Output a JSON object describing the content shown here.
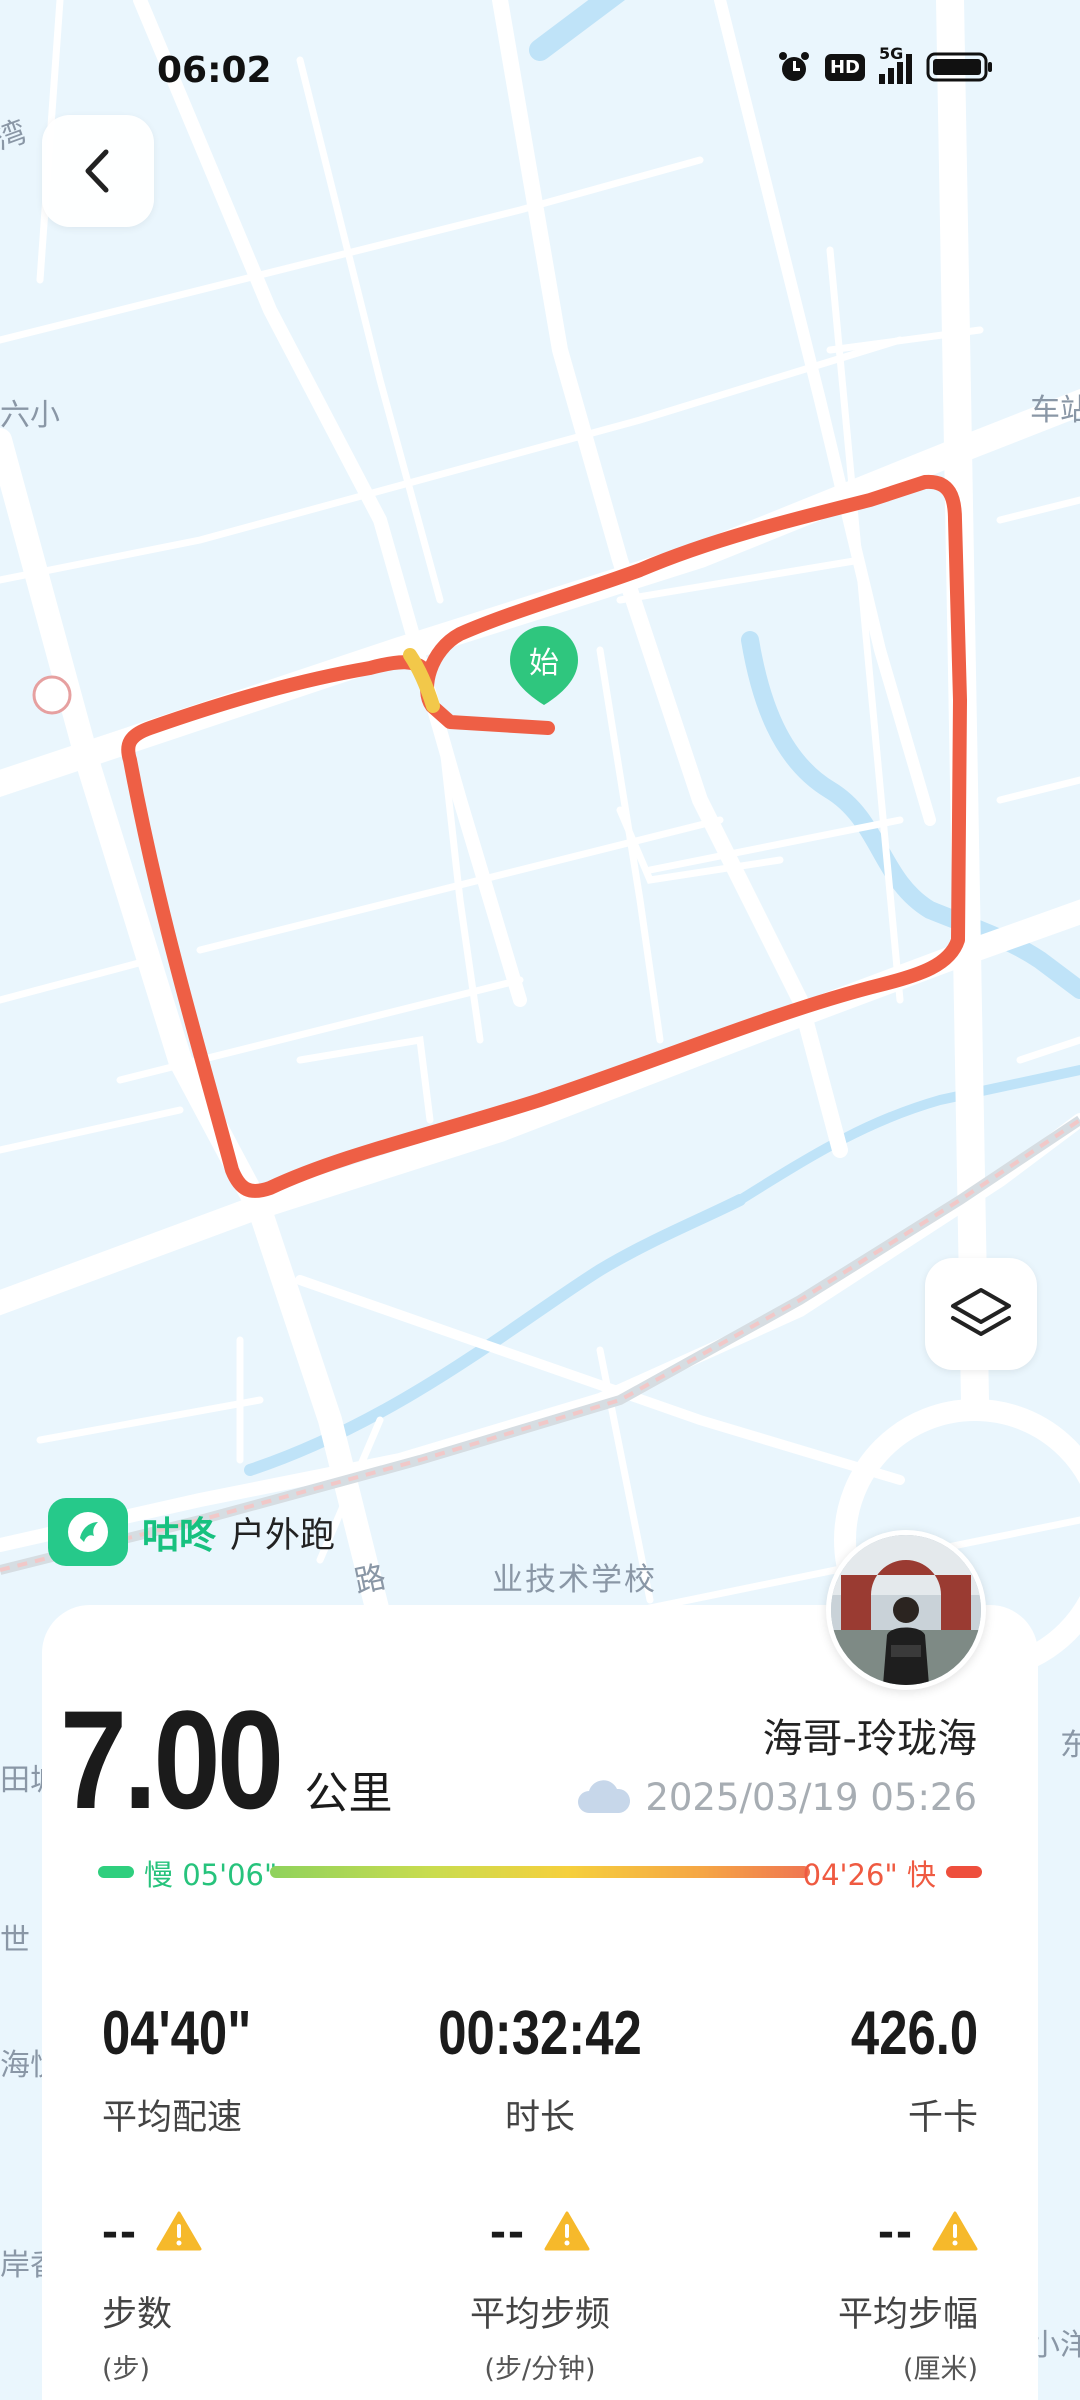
{
  "status_bar": {
    "time": "06:02",
    "network": "5G",
    "hd": "HD"
  },
  "map": {
    "start_marker": "始",
    "labels": {
      "road": "路",
      "school": "业技术学校"
    },
    "colors": {
      "route": "#ee5f45",
      "water": "#bfe3f8",
      "road": "#ffffff",
      "background": "#eaf6fd"
    }
  },
  "brand": {
    "name": "咕咚",
    "activity": "户外跑"
  },
  "run": {
    "distance": "7.00",
    "distance_unit": "公里",
    "user_name": "海哥-玲珑海",
    "date": "2025/03/19 05:26",
    "weather_icon": "cloud-icon"
  },
  "pace_range": {
    "slow_label": "慢 05'06\"",
    "fast_label": "04'26\" 快"
  },
  "stats": {
    "avg_pace": {
      "value": "04'40\"",
      "label": "平均配速"
    },
    "duration": {
      "value": "00:32:42",
      "label": "时长"
    },
    "calories": {
      "value": "426.0",
      "label": "千卡"
    },
    "steps": {
      "value": "--",
      "label": "步数",
      "unit": "(步)"
    },
    "cadence": {
      "value": "--",
      "label": "平均步频",
      "unit": "(步/分钟)"
    },
    "stride": {
      "value": "--",
      "label": "平均步幅",
      "unit": "(厘米)"
    }
  }
}
